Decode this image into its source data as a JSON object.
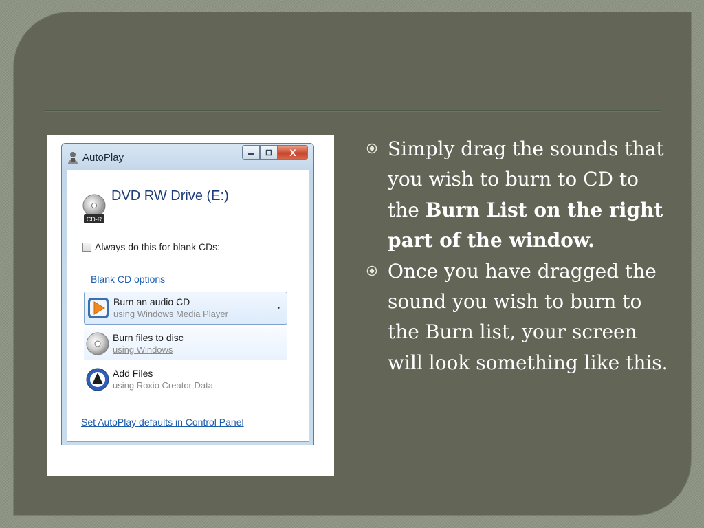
{
  "slide": {
    "background_color": "#636657",
    "bullets": [
      {
        "parts": [
          {
            "text": "Simply drag the sounds that you wish to burn to CD to the ",
            "bold": false
          },
          {
            "text": "Burn List on the right part of the window.",
            "bold": true
          }
        ]
      },
      {
        "parts": [
          {
            "text": "Once you have dragged the sound you wish to burn to the Burn list, your screen will look something like this.",
            "bold": false
          }
        ]
      }
    ]
  },
  "dialog": {
    "title": "AutoPlay",
    "close_label": "X",
    "drive_title": "DVD RW Drive (E:)",
    "cd_badge": "CD-R",
    "always_label": "Always do this for blank CDs:",
    "always_checked": false,
    "section_title": "Blank CD options",
    "options": [
      {
        "main": "Burn an audio CD",
        "sub": "using Windows Media Player",
        "icon": "media-player-icon"
      },
      {
        "main": "Burn files to disc",
        "sub": "using Windows",
        "icon": "disc-icon"
      },
      {
        "main": "Add Files",
        "sub": "using Roxio Creator Data",
        "icon": "roxio-icon"
      }
    ],
    "footer_link": "Set AutoPlay defaults in Control Panel"
  }
}
